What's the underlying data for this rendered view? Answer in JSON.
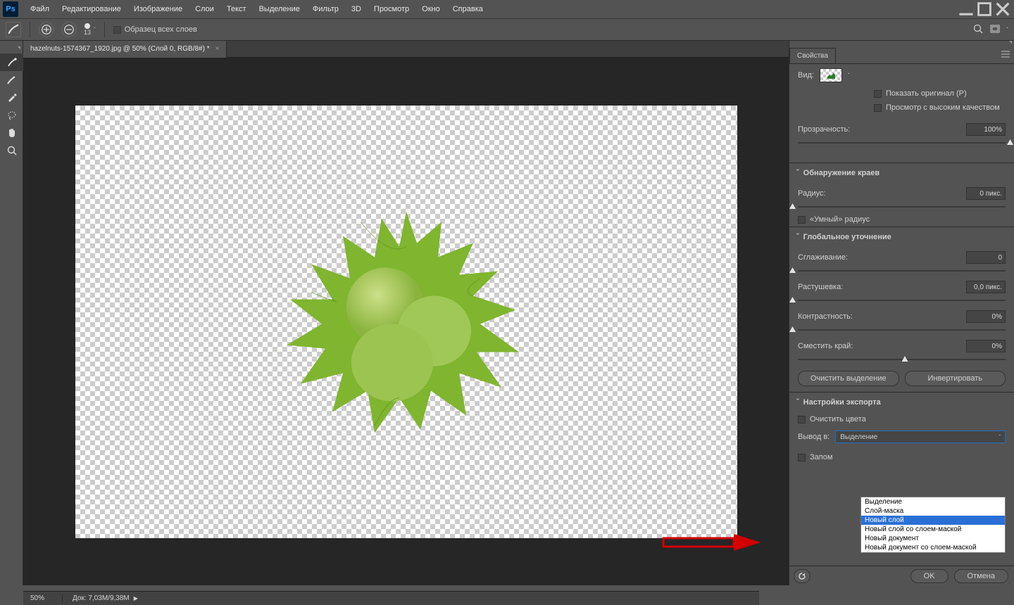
{
  "menu": {
    "items": [
      "Файл",
      "Редактирование",
      "Изображение",
      "Слои",
      "Текст",
      "Выделение",
      "Фильтр",
      "3D",
      "Просмотр",
      "Окно",
      "Справка"
    ]
  },
  "options": {
    "brush_size": "13",
    "sample_all": "Образец всех слоев"
  },
  "doc": {
    "tab_title": "hazelnuts-1574367_1920.jpg @ 50% (Слой 0, RGB/8#) *"
  },
  "panel": {
    "properties_tab": "Свойства",
    "view_label": "Вид:",
    "show_original": "Показать оригинал (Р)",
    "high_quality": "Просмотр с высоким качеством",
    "opacity_label": "Прозрачность:",
    "opacity_value": "100%",
    "edge_detection": "Обнаружение краев",
    "radius_label": "Радиус:",
    "radius_value": "0 пикс.",
    "smart_radius": "«Умный» радиус",
    "global_refine": "Глобальное уточнение",
    "smooth_label": "Сглаживание:",
    "smooth_value": "0",
    "feather_label": "Растушевка:",
    "feather_value": "0,0 пикс.",
    "contrast_label": "Контрастность:",
    "contrast_value": "0%",
    "shift_label": "Сместить край:",
    "shift_value": "0%",
    "clear_sel": "Очистить выделение",
    "invert": "Инвертировать",
    "export_settings": "Настройки экспорта",
    "clean_colors": "Очистить цвета",
    "output_label": "Вывод в:",
    "output_value": "Выделение",
    "remember": "Запом",
    "output_options": [
      "Выделение",
      "Слой-маска",
      "Новый слой",
      "Новый слой со слоем-маской",
      "Новый документ",
      "Новый документ со слоем-маской"
    ],
    "selected_opt_index": 2
  },
  "footer": {
    "ok": "OK",
    "cancel": "Отмена"
  },
  "status": {
    "zoom": "50%",
    "doc": "Док: 7,03M/9,38M"
  }
}
